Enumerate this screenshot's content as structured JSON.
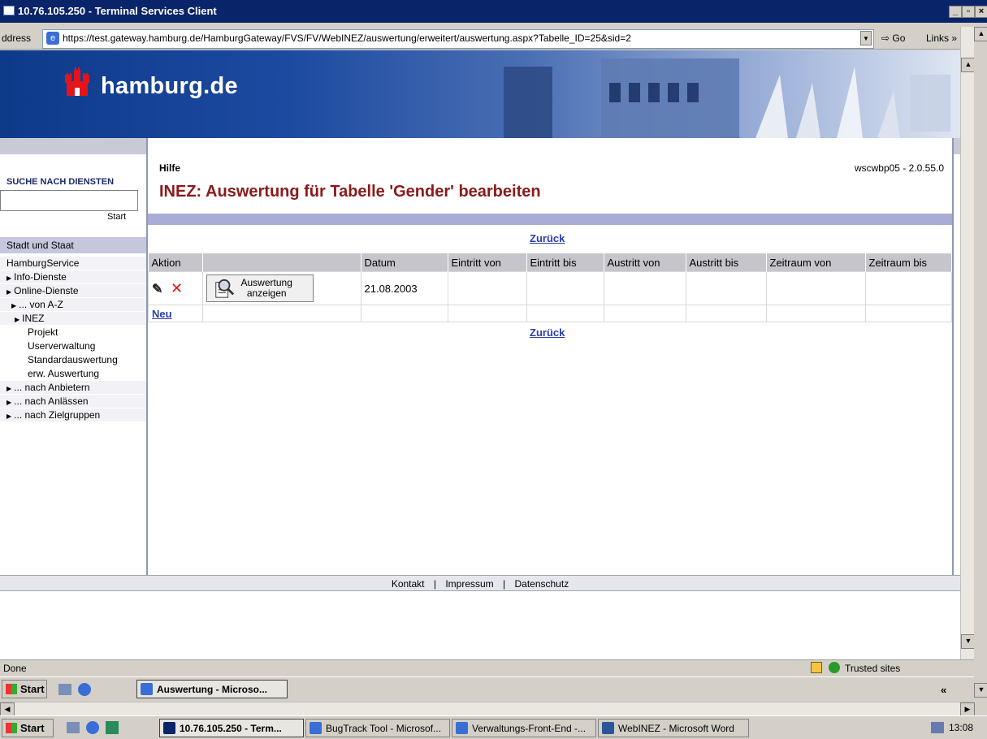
{
  "window": {
    "title": "10.76.105.250 - Terminal Services Client",
    "controls": [
      "_",
      "▫",
      "×"
    ]
  },
  "addressbar": {
    "label": "ddress",
    "url": "https://test.gateway.hamburg.de/HamburgGateway/FVS/FV/WebINEZ/auswertung/erweitert/auswertung.aspx?Tabelle_ID=25&sid=2",
    "go_label": "Go",
    "links_label": "Links »"
  },
  "banner": {
    "site_name": "hamburg.de"
  },
  "sidebar": {
    "search_header": "SUCHE NACH DIENSTEN",
    "search_value": "",
    "start_label": "Start",
    "section_label": "Stadt und Staat",
    "items": [
      {
        "label": "HamburgService",
        "indent": 0,
        "arrow": false
      },
      {
        "label": "Info-Dienste",
        "indent": 0,
        "arrow": true
      },
      {
        "label": "Online-Dienste",
        "indent": 0,
        "arrow": true
      },
      {
        "label": "... von A-Z",
        "indent": 1,
        "arrow": true
      },
      {
        "label": "INEZ",
        "indent": 2,
        "arrow": true
      },
      {
        "label": "Projekt",
        "indent": 3,
        "arrow": false
      },
      {
        "label": "Userverwaltung",
        "indent": 3,
        "arrow": false
      },
      {
        "label": "Standardauswertung",
        "indent": 3,
        "arrow": false
      },
      {
        "label": "erw. Auswertung",
        "indent": 3,
        "arrow": false
      },
      {
        "label": "... nach Anbietern",
        "indent": 0,
        "arrow": true
      },
      {
        "label": "... nach Anlässen",
        "indent": 0,
        "arrow": true
      },
      {
        "label": "... nach Zielgruppen",
        "indent": 0,
        "arrow": true
      }
    ]
  },
  "content": {
    "help_label": "Hilfe",
    "version": "wscwbp05 - 2.0.55.0",
    "title": "INEZ: Auswertung für Tabelle 'Gender' bearbeiten",
    "back_label": "Zurück",
    "new_label": "Neu",
    "table": {
      "headers": [
        "Aktion",
        "",
        "Datum",
        "Eintritt von",
        "Eintritt bis",
        "Austritt von",
        "Austritt bis",
        "Zeitraum von",
        "Zeitraum bis"
      ],
      "rows": [
        {
          "button_label_1": "Auswertung",
          "button_label_2": "anzeigen",
          "datum": "21.08.2003"
        }
      ]
    }
  },
  "footer": {
    "links": [
      "Kontakt",
      "Impressum",
      "Datenschutz"
    ],
    "separator": "|"
  },
  "statusbar": {
    "text": "Done",
    "zone": "Trusted sites"
  },
  "inner_taskbar": {
    "start_label": "Start",
    "task": "Auswertung - Microso...",
    "tray": "«"
  },
  "outer_taskbar": {
    "start_label": "Start",
    "tasks": [
      "10.76.105.250 - Term...",
      "BugTrack Tool - Microsof...",
      "Verwaltungs-Front-End -...",
      "WebINEZ - Microsoft Word"
    ],
    "clock": "13:08"
  }
}
